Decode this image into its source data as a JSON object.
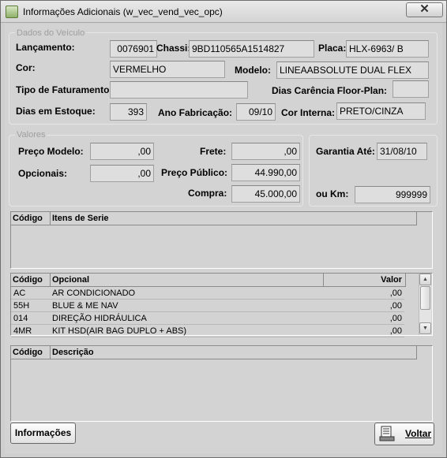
{
  "window": {
    "title": "Informações Adicionais (w_vec_vend_vec_opc)",
    "close_label": "✕"
  },
  "vehicle": {
    "group_title": "Dados do Veículo",
    "lancamento_label": "Lançamento:",
    "lancamento": "0076901",
    "chassi_label": "Chassi:",
    "chassi": "9BD110565A1514827",
    "placa_label": "Placa:",
    "placa": "HLX-6963/ B",
    "cor_label": "Cor:",
    "cor": "VERMELHO",
    "modelo_label": "Modelo:",
    "modelo": "LINEAABSOLUTE DUAL FLEX",
    "tipo_faturamento_label": "Tipo de Faturamento:",
    "tipo_faturamento": "",
    "dias_carencia_label": "Dias Carência Floor-Plan:",
    "dias_carencia": "",
    "dias_estoque_label": "Dias em Estoque:",
    "dias_estoque": "393",
    "ano_fabricacao_label": "Ano Fabricação:",
    "ano_fabricacao": "09/10",
    "cor_interna_label": "Cor Interna:",
    "cor_interna": "PRETO/CINZA"
  },
  "valores": {
    "group_title": "Valores",
    "preco_modelo_label": "Preço Modelo:",
    "preco_modelo": ",00",
    "opcionais_label": "Opcionais:",
    "opcionais": ",00",
    "frete_label": "Frete:",
    "frete": ",00",
    "preco_publico_label": "Preço Público:",
    "preco_publico": "44.990,00",
    "compra_label": "Compra:",
    "compra": "45.000,00",
    "garantia_label": "Garantia Até:",
    "garantia": "31/08/10",
    "km_label": "ou Km:",
    "km": "999999"
  },
  "itens_serie": {
    "col_codigo": "Código",
    "col_itens": "Itens de Serie"
  },
  "opcionais_table": {
    "col_codigo": "Código",
    "col_opcional": "Opcional",
    "col_valor": "Valor",
    "rows": [
      {
        "codigo": "AC",
        "opcional": "AR CONDICIONADO",
        "valor": ",00"
      },
      {
        "codigo": "55H",
        "opcional": "BLUE & ME NAV",
        "valor": ",00"
      },
      {
        "codigo": "014",
        "opcional": "DIREÇÃO HIDRÁULICA",
        "valor": ",00"
      },
      {
        "codigo": "4MR",
        "opcional": "KIT HSD(AIR BAG DUPLO + ABS)",
        "valor": ",00"
      }
    ]
  },
  "descricao_table": {
    "col_codigo": "Código",
    "col_descricao": "Descrição"
  },
  "buttons": {
    "informacoes": "Informações",
    "voltar": "Voltar"
  },
  "icons": {
    "app": "app-icon",
    "close": "close-icon",
    "voltar": "report-icon",
    "scroll_up": "arrow-up-icon",
    "scroll_down": "arrow-down-icon"
  }
}
